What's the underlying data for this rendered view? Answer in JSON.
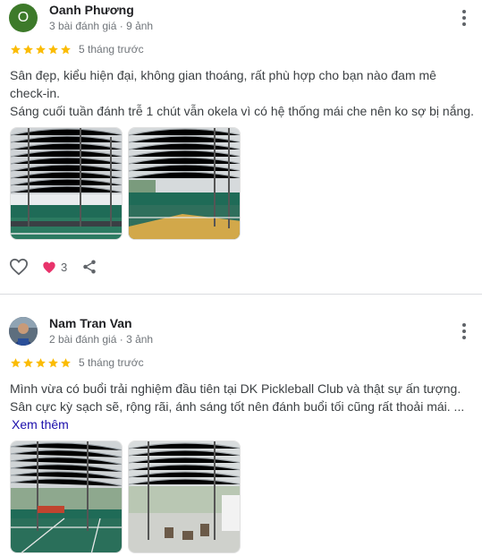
{
  "colors": {
    "star": "#fbbc04",
    "heart_filled": "#e8336b",
    "link": "#1a0dab",
    "avatar1": "#3d7a2a"
  },
  "reviews": [
    {
      "avatar_letter": "O",
      "name": "Oanh Phương",
      "meta": "3 bài đánh giá · 9 ảnh",
      "rating": 5,
      "ago": "5 tháng trước",
      "text_lines": [
        "Sân đẹp, kiểu hiện đại, không gian thoáng, rất phù hợp cho bạn nào đam mê",
        "check-in.",
        "Sáng cuối tuần đánh trễ 1 chút vẫn okela vì có hệ thống mái che nên ko sợ bị nắng."
      ],
      "like_count": "3",
      "icons": [
        "heart-outline-icon",
        "heart-filled-icon",
        "share-icon",
        "more-vert-icon"
      ]
    },
    {
      "name": "Nam Tran Van",
      "meta": "2 bài đánh giá · 3 ảnh",
      "rating": 5,
      "ago": "5 tháng trước",
      "text_lines": [
        "Mình vừa có buổi trải nghiệm đầu tiên tại DK Pickleball Club và thật sự ấn tượng.",
        "Sân cực kỳ sạch sẽ, rộng rãi, ánh sáng tốt nên đánh buổi tối cũng rất thoải mái. ..."
      ],
      "see_more": "Xem thêm",
      "icons": [
        "more-vert-icon"
      ]
    }
  ]
}
